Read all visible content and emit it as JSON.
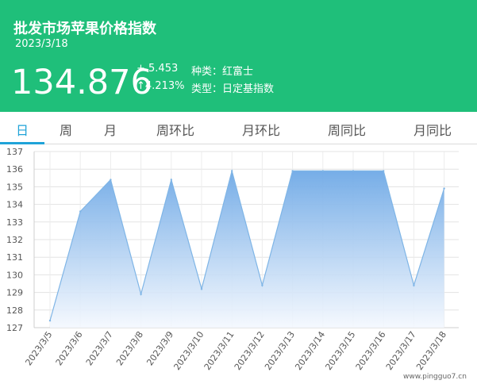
{
  "header": {
    "title": "批发市场苹果价格指数",
    "date": "2023/3/18",
    "price": "134.876",
    "change": "+ 5.453",
    "change_pct": "↑4.213%",
    "kind": "种类：红富士",
    "type": "类型：日定基指数"
  },
  "tabs": [
    {
      "label": "日",
      "active": true
    },
    {
      "label": "周",
      "active": false
    },
    {
      "label": "月",
      "active": false
    },
    {
      "label": "周环比",
      "active": false
    },
    {
      "label": "月环比",
      "active": false
    },
    {
      "label": "周同比",
      "active": false
    },
    {
      "label": "月同比",
      "active": false
    }
  ],
  "colors": {
    "header_bg": "#1fbf7a",
    "accent": "#1fa3d8",
    "line": "#7fb5e6",
    "fill_top": "#6fa9e6",
    "fill_bottom": "#f4f8fe"
  },
  "watermark": "www.pingguo7.cn",
  "chart_data": {
    "type": "area",
    "x": [
      "2023/3/5",
      "2023/3/6",
      "2023/3/7",
      "2023/3/8",
      "2023/3/9",
      "2023/3/10",
      "2023/3/11",
      "2023/3/12",
      "2023/3/13",
      "2023/3/14",
      "2023/3/15",
      "2023/3/16",
      "2023/3/17",
      "2023/3/18"
    ],
    "series": [
      {
        "values": [
          127.4,
          133.6,
          135.4,
          128.9,
          135.4,
          129.2,
          135.9,
          129.4,
          135.9,
          135.9,
          135.9,
          135.9,
          129.4,
          134.9
        ]
      }
    ],
    "ylim": [
      127,
      137
    ],
    "yticks": [
      127,
      128,
      129,
      130,
      131,
      132,
      133,
      134,
      135,
      136,
      137
    ],
    "grid": true
  }
}
